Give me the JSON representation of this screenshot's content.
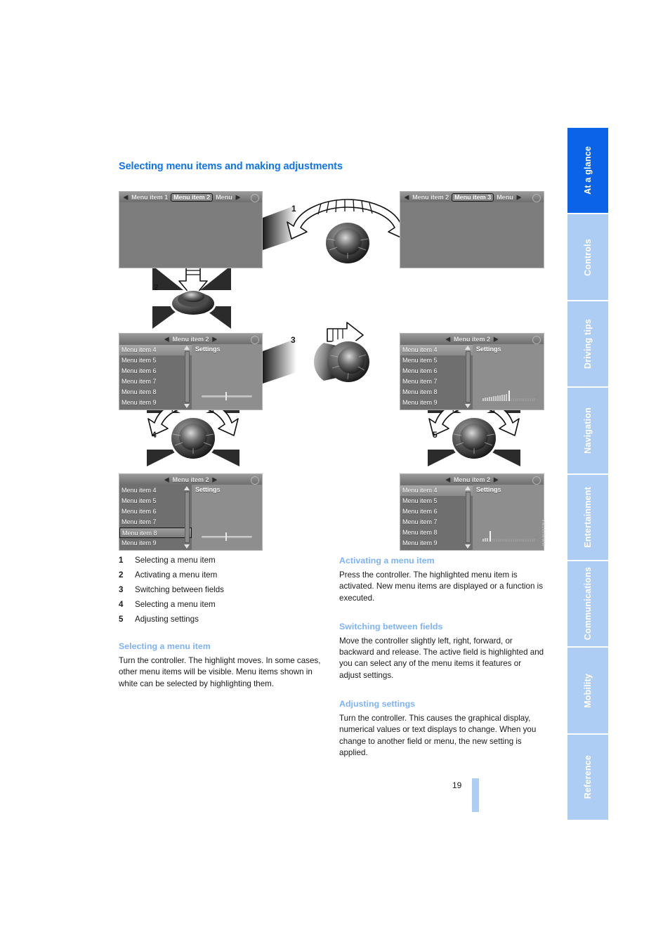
{
  "page": {
    "title": "Selecting menu items and making adjustments",
    "number": "19",
    "figure_code": "VM10JWMW"
  },
  "sidebar": {
    "items": [
      {
        "label": "At a glance",
        "active": true
      },
      {
        "label": "Controls",
        "active": false
      },
      {
        "label": "Driving tips",
        "active": false
      },
      {
        "label": "Navigation",
        "active": false
      },
      {
        "label": "Entertainment",
        "active": false
      },
      {
        "label": "Communications",
        "active": false
      },
      {
        "label": "Mobility",
        "active": false
      },
      {
        "label": "Reference",
        "active": false
      }
    ]
  },
  "figure": {
    "steps": [
      "1",
      "2",
      "3",
      "4",
      "5"
    ],
    "screen_top_left": {
      "tabs": [
        "Menu item 1",
        "Menu item 2",
        "Menu"
      ],
      "selected_tab": "Menu item 2"
    },
    "screen_top_right": {
      "tabs": [
        "Menu item 2",
        "Menu item 3",
        "Menu"
      ],
      "selected_tab": "Menu item 3"
    },
    "screen_mid_left": {
      "title": "Menu item 2",
      "list": [
        "Menu item 4",
        "Menu item 5",
        "Menu item 6",
        "Menu item 7",
        "Menu item 8",
        "Menu item 9"
      ],
      "highlighted": "Menu item 4",
      "right_title": "Settings",
      "widget": "slider"
    },
    "screen_mid_right": {
      "title": "Menu item 2",
      "list": [
        "Menu item 4",
        "Menu item 5",
        "Menu item 6",
        "Menu item 7",
        "Menu item 8",
        "Menu item 9"
      ],
      "highlighted": "Menu item 4",
      "right_title": "Settings",
      "widget": "bargraph"
    },
    "screen_bot_left": {
      "title": "Menu item 2",
      "list": [
        "Menu item 4",
        "Menu item 5",
        "Menu item 6",
        "Menu item 7",
        "Menu item 8",
        "Menu item 9"
      ],
      "highlighted": "Menu item 8",
      "right_title": "Settings",
      "widget": "slider"
    },
    "screen_bot_right": {
      "title": "Menu item 2",
      "list": [
        "Menu item 4",
        "Menu item 5",
        "Menu item 6",
        "Menu item 7",
        "Menu item 8",
        "Menu item 9"
      ],
      "highlighted": "Menu item 4",
      "right_title": "Settings",
      "widget": "bargraph-low"
    }
  },
  "legend": [
    {
      "n": "1",
      "text": "Selecting a menu item"
    },
    {
      "n": "2",
      "text": "Activating a menu item"
    },
    {
      "n": "3",
      "text": "Switching between fields"
    },
    {
      "n": "4",
      "text": "Selecting a menu item"
    },
    {
      "n": "5",
      "text": "Adjusting settings"
    }
  ],
  "sections": {
    "selecting": {
      "heading": "Selecting a menu item",
      "body": "Turn the controller. The highlight moves. In some cases, other menu items will be visible. Menu items shown in white can be selected by highlighting them."
    },
    "activating": {
      "heading": "Activating a menu item",
      "body": "Press the controller. The highlighted menu item is activated. New menu items are displayed or a function is executed."
    },
    "switching": {
      "heading": "Switching between fields",
      "body": "Move the controller slightly left, right, forward, or backward and release. The active field is highlighted and you can select any of the menu items it features or adjust settings."
    },
    "adjusting": {
      "heading": "Adjusting settings",
      "body": "Turn the controller. This causes the graphical display, numerical values or text displays to change. When you change to another field or menu, the new setting is applied."
    }
  },
  "colors": {
    "title_blue": "#1073f0",
    "subhead_blue": "#7eb3f7",
    "tab_active": "#0b63e8",
    "tab_inactive": "#aecdf5"
  }
}
